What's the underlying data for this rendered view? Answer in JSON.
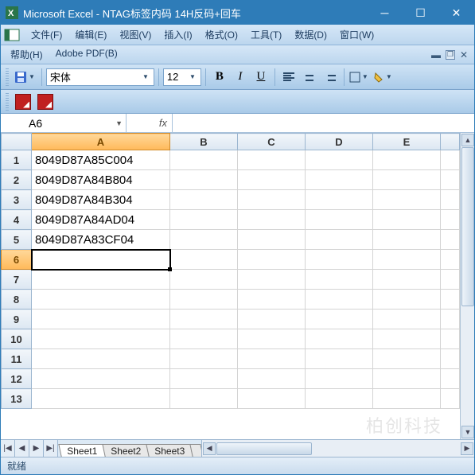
{
  "window": {
    "app": "Microsoft Excel",
    "doc": "NTAG标签内码 14H反码+回车"
  },
  "menu": {
    "file": "文件(F)",
    "edit": "编辑(E)",
    "view": "视图(V)",
    "insert": "插入(I)",
    "format": "格式(O)",
    "tools": "工具(T)",
    "data": "数据(D)",
    "window": "窗口(W)",
    "help": "帮助(H)",
    "adobe": "Adobe PDF(B)"
  },
  "toolbar": {
    "font": "宋体",
    "size": "12"
  },
  "namebox": "A6",
  "fx": "fx",
  "formula": "",
  "columns": [
    "A",
    "B",
    "C",
    "D",
    "E"
  ],
  "active_col": "A",
  "rows": [
    1,
    2,
    3,
    4,
    5,
    6,
    7,
    8,
    9,
    10,
    11,
    12,
    13
  ],
  "active_row": 6,
  "cells": {
    "1": {
      "A": "8049D87A85C004"
    },
    "2": {
      "A": "8049D87A84B804"
    },
    "3": {
      "A": "8049D87A84B304"
    },
    "4": {
      "A": "8049D87A84AD04"
    },
    "5": {
      "A": "8049D87A83CF04"
    }
  },
  "selected": {
    "row": 6,
    "col": "A"
  },
  "sheets": [
    "Sheet1",
    "Sheet2",
    "Sheet3"
  ],
  "active_sheet": "Sheet1",
  "status": "就绪",
  "watermark": "柏创科技"
}
